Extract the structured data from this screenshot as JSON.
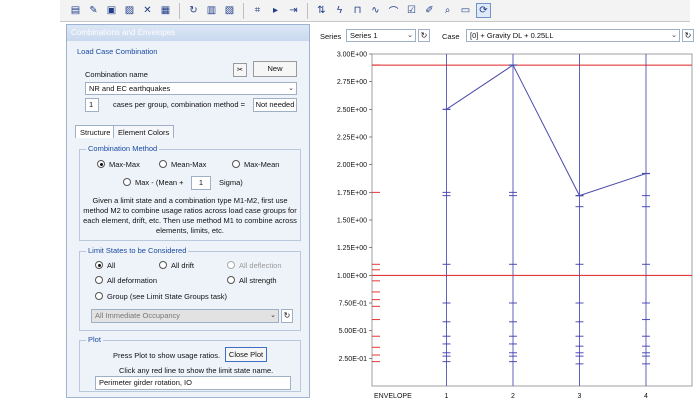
{
  "toolbar": {
    "icons": [
      "layers-icon",
      "edit-icon",
      "save-icon",
      "save-as-icon",
      "cut-icon",
      "table-icon",
      "refresh-icon",
      "report-icon",
      "chart-icon",
      "structure-icon",
      "play-icon",
      "step-icon",
      "sort-icon",
      "bolt-icon",
      "frame-icon",
      "wave-icon",
      "bridge-icon",
      "checklist-icon",
      "edit-chart-icon",
      "zoom-icon",
      "label-icon",
      "spin-icon"
    ]
  },
  "panel": {
    "title": "Combinations and Envelopes",
    "load_case_group": {
      "label": "Load Case Combination",
      "combination_name_label": "Combination  name",
      "new_button": "New",
      "combination_name": "NR and EC earthquakes",
      "cases_per_group": "1",
      "cases_label": "cases per group, combination method =",
      "method_value": "Not needed"
    },
    "tabs": [
      "Structure",
      "Element Colors"
    ],
    "combination_method": {
      "label": "Combination Method",
      "options": [
        "Max-Max",
        "Mean-Max",
        "Max-Mean"
      ],
      "option4_prefix": "Max - (Mean +",
      "option4_value": "1",
      "option4_suffix": "Sigma)",
      "description_lines": [
        "Given a limit state and a combination type M1-M2, first use",
        "method M2 to combine usage ratios across load case groups for",
        "each element, drift, etc. Then use method M1 to combine across",
        "elements, limits, etc."
      ]
    },
    "limit_states": {
      "label": "Limit States to be Considered",
      "options": [
        "All",
        "All drift",
        "All deflection",
        "All deformation",
        "All strength",
        "Group (see Limit State Groups task)"
      ],
      "group_select": "All Immediate Occupancy"
    },
    "plot": {
      "label": "Plot",
      "instruction": "Press Plot to show usage ratios.",
      "button": "Close Plot",
      "hint": "Click any red line to show the limit state name.",
      "selected": "Perimeter girder rotation, IO"
    }
  },
  "chart_controls": {
    "series_label": "Series",
    "series_value": "Series 1",
    "case_label": "Case",
    "case_value": "[0] + Gravity DL + 0.25LL"
  },
  "colors": {
    "series_line": "#4a4aa8",
    "limit_line": "#e02020",
    "grid": "#3b3bb0"
  },
  "chart_data": {
    "type": "line",
    "categories": [
      "ENVELOPE",
      "1",
      "2",
      "3",
      "4"
    ],
    "y_ticks": [
      "3.00E+00",
      "2.75E+00",
      "2.50E+00",
      "2.25E+00",
      "2.00E+00",
      "1.75E+00",
      "1.50E+00",
      "1.25E+00",
      "1.00E+00",
      "7.50E-01",
      "5.00E-01",
      "2.50E-01"
    ],
    "ylim": [
      0,
      3
    ],
    "series": [
      {
        "name": "Series 1",
        "x": [
          "1",
          "2",
          "3",
          "4"
        ],
        "values": [
          2.5,
          2.9,
          1.72,
          1.92
        ]
      }
    ],
    "limit_lines": [
      2.9,
      1.0
    ],
    "grid": true
  }
}
